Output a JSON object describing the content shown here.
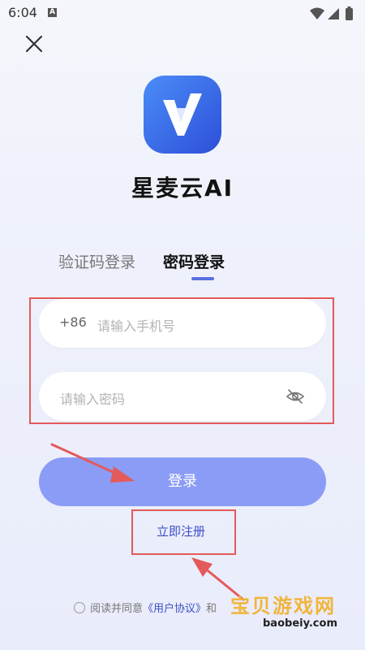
{
  "statusbar": {
    "time": "6:04",
    "app_badge": "A"
  },
  "header": {
    "close_icon": "close-icon"
  },
  "app": {
    "name": "星麦云AI",
    "logo_color": "#3d62e8"
  },
  "tabs": [
    {
      "label": "验证码登录",
      "active": false
    },
    {
      "label": "密码登录",
      "active": true
    }
  ],
  "form": {
    "phone_prefix": "+86",
    "phone_placeholder": "请输入手机号",
    "password_placeholder": "请输入密码"
  },
  "actions": {
    "login_label": "登录",
    "register_label": "立即注册"
  },
  "agreement": {
    "prefix": "阅读并同意",
    "user_agreement": "《用户协议》",
    "and": "和"
  },
  "watermark": {
    "text": "宝贝游戏网",
    "url": "baobeiy.com"
  },
  "colors": {
    "accent": "#5a6ee0",
    "login_button": "#8a9cf5",
    "annotation": "#e35a5a"
  }
}
